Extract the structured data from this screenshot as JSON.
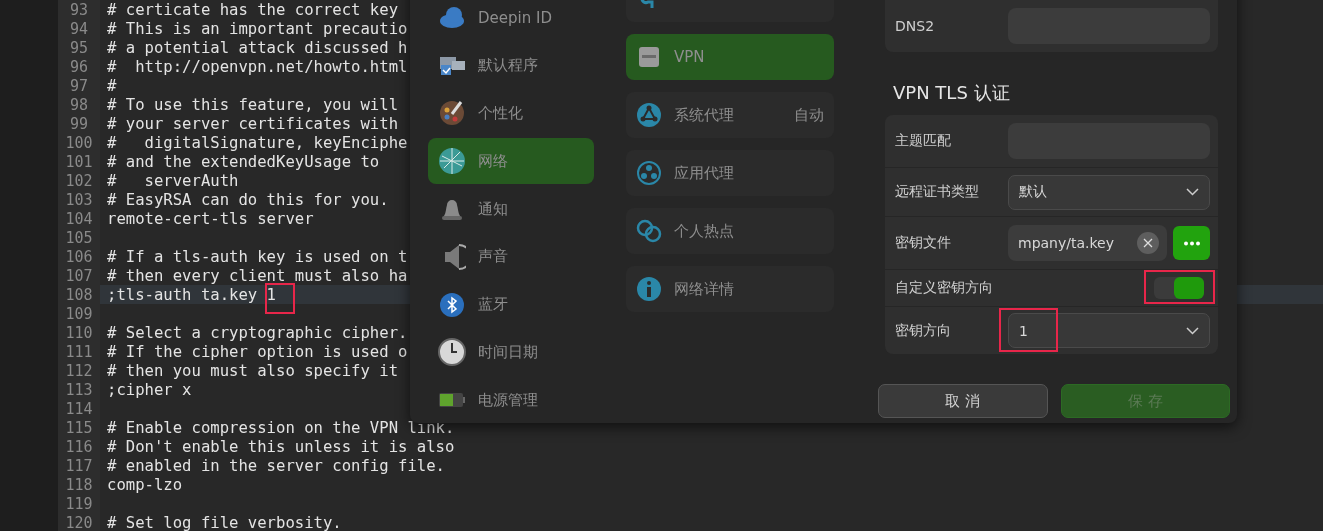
{
  "editor": {
    "lines": [
      {
        "number": "93",
        "text": "# certicate has the correct key",
        "current": false
      },
      {
        "number": "94",
        "text": "# This is an important precautio",
        "current": false
      },
      {
        "number": "95",
        "text": "# a potential attack discussed h",
        "current": false
      },
      {
        "number": "96",
        "text": "#  http://openvpn.net/howto.html",
        "current": false
      },
      {
        "number": "97",
        "text": "#",
        "current": false
      },
      {
        "number": "98",
        "text": "# To use this feature, you will",
        "current": false
      },
      {
        "number": "99",
        "text": "# your server certificates with",
        "current": false
      },
      {
        "number": "100",
        "text": "#   digitalSignature, keyEnciphe",
        "current": false
      },
      {
        "number": "101",
        "text": "# and the extendedKeyUsage to",
        "current": false
      },
      {
        "number": "102",
        "text": "#   serverAuth",
        "current": false
      },
      {
        "number": "103",
        "text": "# EasyRSA can do this for you.",
        "current": false
      },
      {
        "number": "104",
        "text": "remote-cert-tls server",
        "current": false
      },
      {
        "number": "105",
        "current": false
      },
      {
        "number": "106",
        "text": "# If a tls-auth key is used on t",
        "current": false
      },
      {
        "number": "107",
        "text": "# then every client must also ha",
        "current": false
      },
      {
        "number": "108",
        "text": ";tls-auth ta.key 1",
        "current": true
      },
      {
        "number": "109",
        "current": false
      },
      {
        "number": "110",
        "text": "# Select a cryptographic cipher.",
        "current": false
      },
      {
        "number": "111",
        "text": "# If the cipher option is used o",
        "current": false
      },
      {
        "number": "112",
        "text": "# then you must also specify it",
        "current": false
      },
      {
        "number": "113",
        "text": ";cipher x",
        "current": false
      },
      {
        "number": "114",
        "current": false
      },
      {
        "number": "115",
        "text": "# Enable compression on the VPN link.",
        "current": false
      },
      {
        "number": "116",
        "text": "# Don't enable this unless it is also",
        "current": false
      },
      {
        "number": "117",
        "text": "# enabled in the server config file.",
        "current": false
      },
      {
        "number": "118",
        "text": "comp-lzo",
        "current": false
      },
      {
        "number": "119",
        "current": false
      },
      {
        "number": "120",
        "text": "# Set log file verbosity.",
        "current": false
      }
    ]
  },
  "settings_dialog": {
    "sidebar": {
      "items": [
        {
          "label": "Deepin ID",
          "selected": false
        },
        {
          "label": "默认程序",
          "selected": false
        },
        {
          "label": "个性化",
          "selected": false
        },
        {
          "label": "网络",
          "selected": true
        },
        {
          "label": "通知",
          "selected": false
        },
        {
          "label": "声音",
          "selected": false
        },
        {
          "label": "蓝牙",
          "selected": false
        },
        {
          "label": "时间日期",
          "selected": false
        },
        {
          "label": "电源管理",
          "selected": false
        }
      ]
    },
    "network_menu": {
      "items": [
        {
          "kind": "cut",
          "selected": false
        },
        {
          "label": "VPN",
          "selected": true
        },
        {
          "label": "系统代理",
          "value": "自动",
          "selected": false
        },
        {
          "label": "应用代理",
          "selected": false
        },
        {
          "label": "个人热点",
          "selected": false
        },
        {
          "label": "网络详情",
          "selected": false
        }
      ]
    },
    "dns_rows": [
      {
        "kind": "input",
        "label": "DNS2"
      }
    ],
    "tls_section": {
      "heading": "VPN TLS 认证",
      "rows": [
        {
          "kind": "input",
          "label": "主题匹配"
        },
        {
          "kind": "select",
          "label": "远程证书类型",
          "value": "默认"
        },
        {
          "kind": "file",
          "label": "密钥文件",
          "value": "mpany/ta.key"
        },
        {
          "kind": "toggle",
          "label": "自定义密钥方向",
          "on": true
        },
        {
          "kind": "select",
          "label": "密钥方向",
          "value": "1"
        }
      ]
    },
    "buttons": [
      {
        "label": "取 消",
        "kind": "cancel",
        "disabled": false
      },
      {
        "label": "保 存",
        "kind": "save",
        "disabled": true
      }
    ]
  }
}
